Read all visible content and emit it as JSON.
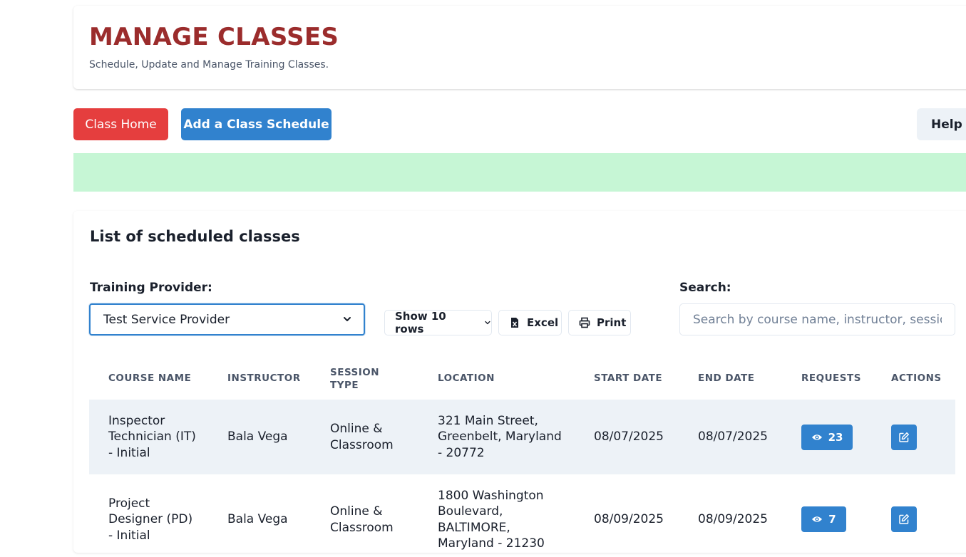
{
  "header": {
    "title": "MANAGE CLASSES",
    "subtitle": "Schedule, Update and Manage Training Classes."
  },
  "toolbar": {
    "class_home": "Class Home",
    "add_schedule": "Add a Class Schedule",
    "help": "Help"
  },
  "list": {
    "title": "List of scheduled classes",
    "provider_label": "Training Provider:",
    "provider_value": "Test Service Provider",
    "show_rows": "Show 10 rows",
    "excel": "Excel",
    "print": "Print",
    "search_label": "Search:",
    "search_placeholder": "Search by course name, instructor, session type..."
  },
  "table": {
    "headers": {
      "course": "COURSE NAME",
      "instructor": "INSTRUCTOR",
      "session_1": "SESSION",
      "session_2": "TYPE",
      "location": "LOCATION",
      "start": "START DATE",
      "end": "END DATE",
      "requests": "REQUESTS",
      "actions": "ACTIONS"
    },
    "rows": [
      {
        "course_1": "Inspector",
        "course_2": "Technician (IT)",
        "course_3": "- Initial",
        "instructor": "Bala Vega",
        "session_1": "Online &",
        "session_2": "Classroom",
        "location_1": "321 Main Street,",
        "location_2": "Greenbelt, Maryland",
        "location_3": "- 20772",
        "start": "08/07/2025",
        "end": "08/07/2025",
        "requests": "23"
      },
      {
        "course_1": "Project",
        "course_2": "Designer (PD)",
        "course_3": "- Initial",
        "instructor": "Bala Vega",
        "session_1": "Online &",
        "session_2": "Classroom",
        "location_1": "1800 Washington",
        "location_2": "Boulevard,",
        "location_3": "BALTIMORE,",
        "location_4": "Maryland - 21230",
        "start": "08/09/2025",
        "end": "08/09/2025",
        "requests": "7"
      }
    ]
  },
  "colors": {
    "title": "#9b2c2c",
    "danger": "#e53e3e",
    "primary": "#3182ce",
    "success_bg": "#c6f6d5",
    "row_alt": "#edf2f7"
  }
}
